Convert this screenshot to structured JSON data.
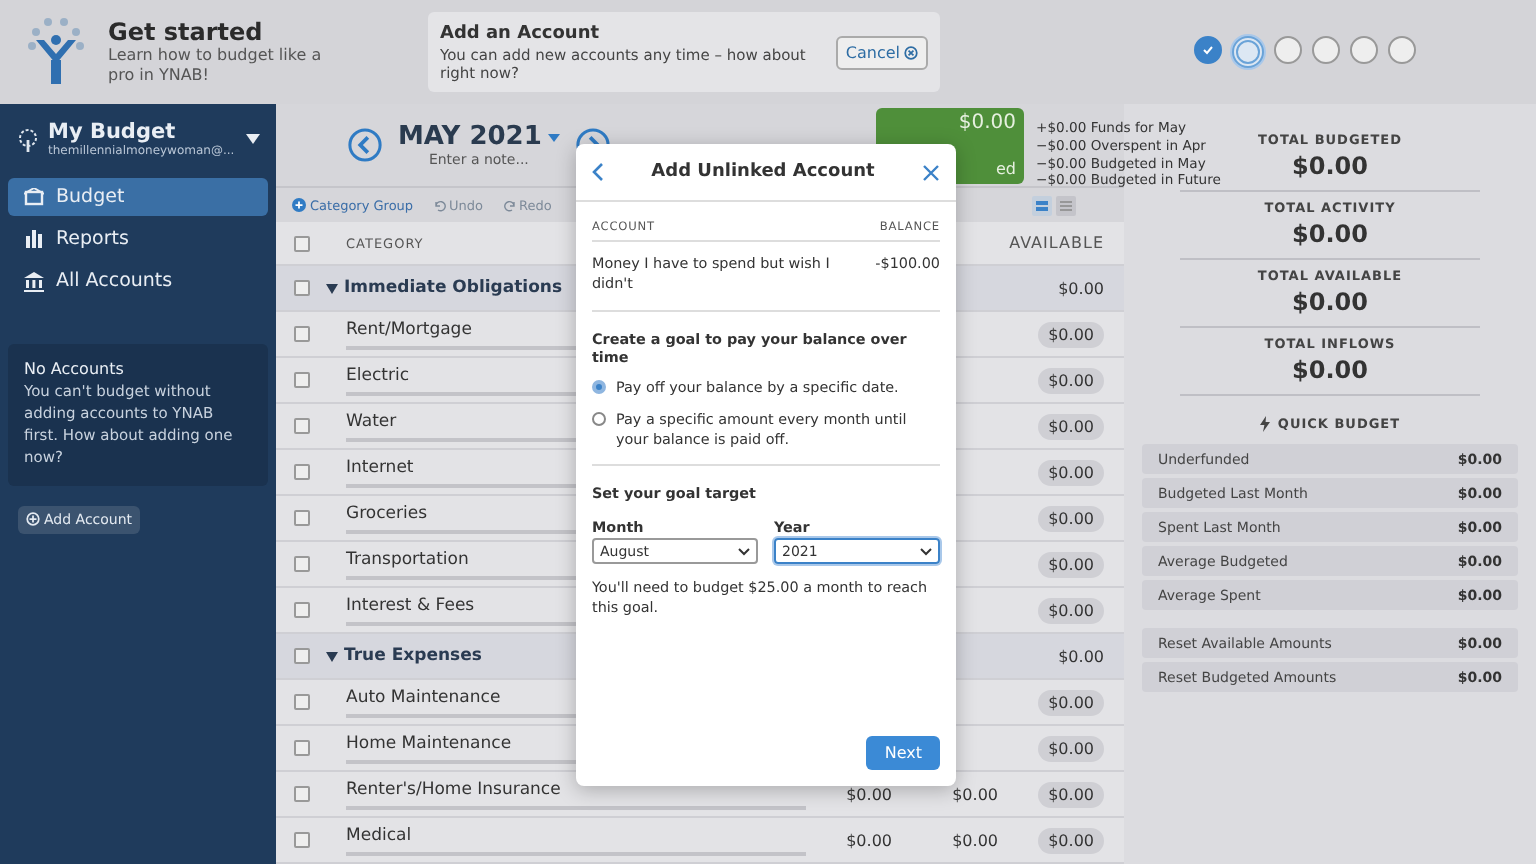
{
  "onboarding": {
    "title": "Get started",
    "subtitle": "Learn how to budget like a pro in YNAB!",
    "card": {
      "title": "Add an Account",
      "text": "You can add new accounts any time – how about right now?",
      "cancel": "Cancel"
    },
    "steps": [
      {
        "checked": true,
        "selected": false
      },
      {
        "checked": false,
        "selected": true
      },
      {
        "checked": false,
        "selected": false
      },
      {
        "checked": false,
        "selected": false
      },
      {
        "checked": false,
        "selected": false
      },
      {
        "checked": false,
        "selected": false
      }
    ]
  },
  "sidebar": {
    "budget_name": "My Budget",
    "email": "themillennialmoneywoman@...",
    "items": [
      {
        "label": "Budget",
        "selected": true
      },
      {
        "label": "Reports",
        "selected": false
      },
      {
        "label": "All Accounts",
        "selected": false
      }
    ],
    "notice": {
      "title": "No Accounts",
      "text": "You can't budget without adding accounts to YNAB first. How about adding one now?"
    },
    "add_account": "Add Account"
  },
  "month": {
    "label": "MAY 2021",
    "note_placeholder": "Enter a note..."
  },
  "to_be_budgeted": {
    "amount": "$0.00",
    "label": "ed"
  },
  "funds": [
    {
      "amount": "+$0.00",
      "label": "Funds for May"
    },
    {
      "amount": "−$0.00",
      "label": "Overspent in Apr"
    },
    {
      "amount": "−$0.00",
      "label": "Budgeted in May"
    },
    {
      "amount": "−$0.00",
      "label": "Budgeted in Future"
    }
  ],
  "toolbar": {
    "add_group": "Category Group",
    "undo": "Undo",
    "redo": "Redo"
  },
  "table": {
    "columns": [
      "CATEGORY",
      "AVAILABLE"
    ],
    "all_checked": false,
    "rows": [
      {
        "kind": "group",
        "name": "Immediate Obligations",
        "available": "$0.00",
        "checked": false,
        "expanded": true
      },
      {
        "kind": "category",
        "name": "Rent/Mortgage",
        "available": "$0.00",
        "checked": false
      },
      {
        "kind": "category",
        "name": "Electric",
        "available": "$0.00",
        "checked": false
      },
      {
        "kind": "category",
        "name": "Water",
        "available": "$0.00",
        "checked": false
      },
      {
        "kind": "category",
        "name": "Internet",
        "available": "$0.00",
        "checked": false
      },
      {
        "kind": "category",
        "name": "Groceries",
        "available": "$0.00",
        "checked": false
      },
      {
        "kind": "category",
        "name": "Transportation",
        "available": "$0.00",
        "checked": false
      },
      {
        "kind": "category",
        "name": "Interest & Fees",
        "available": "$0.00",
        "checked": false
      },
      {
        "kind": "group",
        "name": "True Expenses",
        "available": "$0.00",
        "checked": false,
        "expanded": true
      },
      {
        "kind": "category",
        "name": "Auto Maintenance",
        "available": "$0.00",
        "checked": false
      },
      {
        "kind": "category",
        "name": "Home Maintenance",
        "available": "$0.00",
        "checked": false
      },
      {
        "kind": "category",
        "name": "Renter's/Home Insurance",
        "budgeted": "$0.00",
        "activity": "$0.00",
        "available": "$0.00",
        "checked": false
      },
      {
        "kind": "category",
        "name": "Medical",
        "budgeted": "$0.00",
        "activity": "$0.00",
        "available": "$0.00",
        "checked": false
      }
    ]
  },
  "totals": [
    {
      "label": "TOTAL BUDGETED",
      "value": "$0.00"
    },
    {
      "label": "TOTAL ACTIVITY",
      "value": "$0.00"
    },
    {
      "label": "TOTAL AVAILABLE",
      "value": "$0.00"
    },
    {
      "label": "TOTAL INFLOWS",
      "value": "$0.00"
    }
  ],
  "quick_budget": {
    "title": "QUICK BUDGET",
    "items": [
      {
        "label": "Underfunded",
        "value": "$0.00"
      },
      {
        "label": "Budgeted Last Month",
        "value": "$0.00"
      },
      {
        "label": "Spent Last Month",
        "value": "$0.00"
      },
      {
        "label": "Average Budgeted",
        "value": "$0.00"
      },
      {
        "label": "Average Spent",
        "value": "$0.00"
      }
    ],
    "reset_items": [
      {
        "label": "Reset Available Amounts",
        "value": "$0.00"
      },
      {
        "label": "Reset Budgeted Amounts",
        "value": "$0.00"
      }
    ]
  },
  "modal": {
    "title": "Add Unlinked Account",
    "columns": [
      "ACCOUNT",
      "BALANCE"
    ],
    "account": "Money I have to spend but wish I didn't",
    "balance": "-$100.00",
    "goal_heading": "Create a goal to pay your balance over time",
    "options": [
      {
        "label": "Pay off your balance by a specific date.",
        "selected": true
      },
      {
        "label": "Pay a specific amount every month until your balance is paid off.",
        "selected": false
      }
    ],
    "target_heading": "Set your goal target",
    "month_label": "Month",
    "month": "August",
    "year_label": "Year",
    "year": "2021",
    "note": "You'll need to budget $25.00 a month to reach this goal.",
    "next": "Next"
  }
}
